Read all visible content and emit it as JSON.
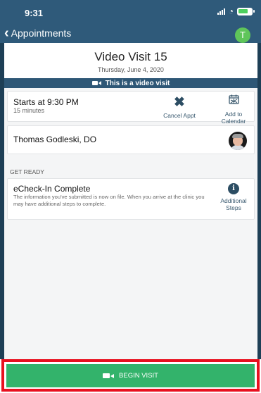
{
  "status_bar": {
    "time": "9:31",
    "battery_color": "#4ccf5e"
  },
  "nav": {
    "back_label": "Appointments",
    "avatar_initial": "T",
    "avatar_color": "#5fc55a"
  },
  "visit": {
    "title": "Video Visit 15",
    "date": "Thursday, June 4, 2020",
    "banner_text": "This is a video visit"
  },
  "appointment": {
    "starts": "Starts at 9:30 PM",
    "duration": "15 minutes",
    "cancel_label": "Cancel Appt",
    "calendar_label_1": "Add to",
    "calendar_label_2": "Calendar"
  },
  "provider": {
    "name": "Thomas Godleski, DO"
  },
  "get_ready": {
    "heading": "GET READY",
    "echeck_title": "eCheck-In Complete",
    "echeck_desc": "The information you've submitted is now on file. When you arrive at the clinic you may have additional steps to complete.",
    "steps_label_1": "Additional",
    "steps_label_2": "Steps"
  },
  "footer": {
    "begin_label": "BEGIN VISIT",
    "button_color": "#33b36b",
    "highlight_color": "#e8101f"
  },
  "colors": {
    "header": "#2f5a7a",
    "banner": "#2e5776",
    "accent_dark": "#2c4d63"
  }
}
